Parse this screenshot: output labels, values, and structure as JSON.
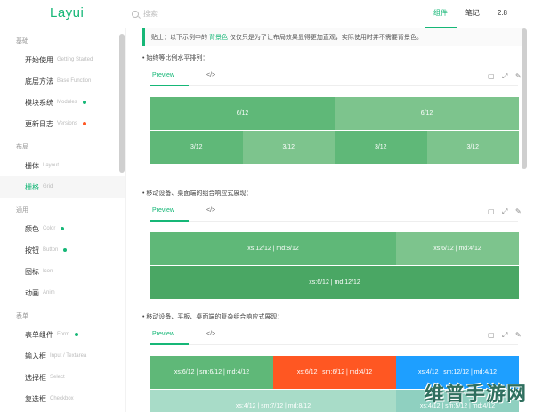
{
  "header": {
    "logo": "Layui",
    "search_placeholder": "搜索",
    "nav": [
      {
        "label": "组件",
        "active": true
      },
      {
        "label": "笔记",
        "active": false
      },
      {
        "label": "2.8",
        "active": false
      }
    ]
  },
  "sidebar": {
    "sections": [
      {
        "title": "基础",
        "items": [
          {
            "cn": "开始使用",
            "en": "Getting Started",
            "dot": ""
          },
          {
            "cn": "底层方法",
            "en": "Base Function",
            "dot": ""
          },
          {
            "cn": "模块系统",
            "en": "Modules",
            "dot": "#16b777"
          },
          {
            "cn": "更新日志",
            "en": "Versions",
            "dot": "#ff5722"
          }
        ]
      },
      {
        "title": "布局",
        "items": [
          {
            "cn": "栅体",
            "en": "Layout",
            "dot": ""
          },
          {
            "cn": "栅格",
            "en": "Grid",
            "dot": "",
            "active": true
          }
        ]
      },
      {
        "title": "通用",
        "items": [
          {
            "cn": "颜色",
            "en": "Color",
            "dot": "#16b777"
          },
          {
            "cn": "按钮",
            "en": "Button",
            "dot": "#16b777"
          },
          {
            "cn": "图标",
            "en": "Icon",
            "dot": ""
          },
          {
            "cn": "动画",
            "en": "Anim",
            "dot": ""
          }
        ]
      },
      {
        "title": "表单",
        "items": [
          {
            "cn": "表单组件",
            "en": "Form",
            "dot": "#16b777"
          },
          {
            "cn": "输入框",
            "en": "Input / Textarea",
            "dot": ""
          },
          {
            "cn": "选择框",
            "en": "Select",
            "dot": ""
          },
          {
            "cn": "复选框",
            "en": "Checkbox",
            "dot": ""
          }
        ]
      }
    ]
  },
  "main": {
    "tip_prefix": "贴士：以下示例中的",
    "tip_em": "背景色",
    "tip_suffix": "仅仅只是为了让布局效果显得更加直观，实际使用时并不需要背景色。",
    "tab_preview": "Preview",
    "tab_code": "</>",
    "tool_icons": [
      "doc-icon",
      "expand-icon",
      "edit-icon"
    ],
    "tool_glyphs": [
      "▢",
      "⤢",
      "✎"
    ],
    "sections": [
      {
        "label": "始终等比例水平排列：",
        "rows": [
          [
            {
              "text": "6/12",
              "span": 6,
              "color": "#5fb878"
            },
            {
              "text": "6/12",
              "span": 6,
              "color": "#7dc48d"
            }
          ],
          [
            {
              "text": "3/12",
              "span": 3,
              "color": "#5fb878"
            },
            {
              "text": "3/12",
              "span": 3,
              "color": "#7dc48d"
            },
            {
              "text": "3/12",
              "span": 3,
              "color": "#5fb878"
            },
            {
              "text": "3/12",
              "span": 3,
              "color": "#7dc48d"
            }
          ]
        ]
      },
      {
        "label": "移动设备、桌面端的组合响应式展现：",
        "rows": [
          [
            {
              "text": "xs:12/12 | md:8/12",
              "span": 8,
              "color": "#5fb878"
            },
            {
              "text": "xs:6/12 | md:4/12",
              "span": 4,
              "color": "#7dc48d"
            }
          ],
          [
            {
              "text": "xs:6/12 | md:12/12",
              "span": 12,
              "color": "#4aa764"
            }
          ]
        ]
      },
      {
        "label": "移动设备、平板、桌面端的复杂组合响应式展现：",
        "rows": [
          [
            {
              "text": "xs:6/12 | sm:6/12 | md:4/12",
              "span": 4,
              "color": "#5fb878"
            },
            {
              "text": "xs:6/12 | sm:6/12 | md:4/12",
              "span": 4,
              "color": "#ff5722"
            },
            {
              "text": "xs:4/12 | sm:12/12 | md:4/12",
              "span": 4,
              "color": "#1e9fff"
            }
          ],
          [
            {
              "text": "xs:4/12 | sm:7/12 | md:8/12",
              "span": 8,
              "color": "#a8dcc8"
            },
            {
              "text": "xs:4/12 | sm:5/12 | md:4/12",
              "span": 4,
              "color": "#8fd0c0"
            }
          ]
        ]
      }
    ]
  },
  "watermark": "维普手游网"
}
